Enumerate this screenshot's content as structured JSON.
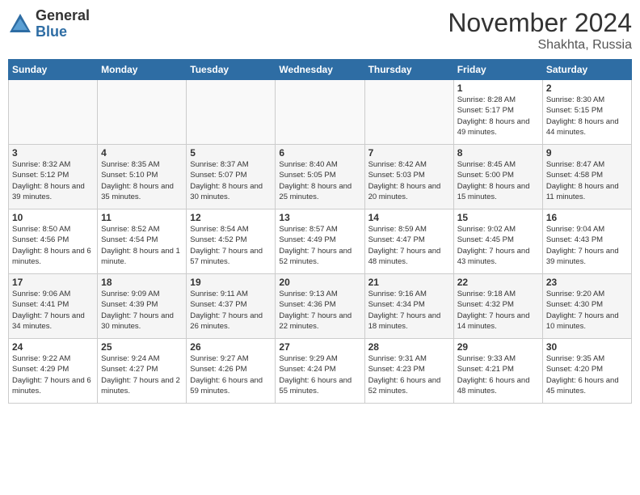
{
  "logo": {
    "general": "General",
    "blue": "Blue"
  },
  "title": "November 2024",
  "location": "Shakhta, Russia",
  "days_header": [
    "Sunday",
    "Monday",
    "Tuesday",
    "Wednesday",
    "Thursday",
    "Friday",
    "Saturday"
  ],
  "weeks": [
    [
      {
        "day": "",
        "info": ""
      },
      {
        "day": "",
        "info": ""
      },
      {
        "day": "",
        "info": ""
      },
      {
        "day": "",
        "info": ""
      },
      {
        "day": "",
        "info": ""
      },
      {
        "day": "1",
        "info": "Sunrise: 8:28 AM\nSunset: 5:17 PM\nDaylight: 8 hours and 49 minutes."
      },
      {
        "day": "2",
        "info": "Sunrise: 8:30 AM\nSunset: 5:15 PM\nDaylight: 8 hours and 44 minutes."
      }
    ],
    [
      {
        "day": "3",
        "info": "Sunrise: 8:32 AM\nSunset: 5:12 PM\nDaylight: 8 hours and 39 minutes."
      },
      {
        "day": "4",
        "info": "Sunrise: 8:35 AM\nSunset: 5:10 PM\nDaylight: 8 hours and 35 minutes."
      },
      {
        "day": "5",
        "info": "Sunrise: 8:37 AM\nSunset: 5:07 PM\nDaylight: 8 hours and 30 minutes."
      },
      {
        "day": "6",
        "info": "Sunrise: 8:40 AM\nSunset: 5:05 PM\nDaylight: 8 hours and 25 minutes."
      },
      {
        "day": "7",
        "info": "Sunrise: 8:42 AM\nSunset: 5:03 PM\nDaylight: 8 hours and 20 minutes."
      },
      {
        "day": "8",
        "info": "Sunrise: 8:45 AM\nSunset: 5:00 PM\nDaylight: 8 hours and 15 minutes."
      },
      {
        "day": "9",
        "info": "Sunrise: 8:47 AM\nSunset: 4:58 PM\nDaylight: 8 hours and 11 minutes."
      }
    ],
    [
      {
        "day": "10",
        "info": "Sunrise: 8:50 AM\nSunset: 4:56 PM\nDaylight: 8 hours and 6 minutes."
      },
      {
        "day": "11",
        "info": "Sunrise: 8:52 AM\nSunset: 4:54 PM\nDaylight: 8 hours and 1 minute."
      },
      {
        "day": "12",
        "info": "Sunrise: 8:54 AM\nSunset: 4:52 PM\nDaylight: 7 hours and 57 minutes."
      },
      {
        "day": "13",
        "info": "Sunrise: 8:57 AM\nSunset: 4:49 PM\nDaylight: 7 hours and 52 minutes."
      },
      {
        "day": "14",
        "info": "Sunrise: 8:59 AM\nSunset: 4:47 PM\nDaylight: 7 hours and 48 minutes."
      },
      {
        "day": "15",
        "info": "Sunrise: 9:02 AM\nSunset: 4:45 PM\nDaylight: 7 hours and 43 minutes."
      },
      {
        "day": "16",
        "info": "Sunrise: 9:04 AM\nSunset: 4:43 PM\nDaylight: 7 hours and 39 minutes."
      }
    ],
    [
      {
        "day": "17",
        "info": "Sunrise: 9:06 AM\nSunset: 4:41 PM\nDaylight: 7 hours and 34 minutes."
      },
      {
        "day": "18",
        "info": "Sunrise: 9:09 AM\nSunset: 4:39 PM\nDaylight: 7 hours and 30 minutes."
      },
      {
        "day": "19",
        "info": "Sunrise: 9:11 AM\nSunset: 4:37 PM\nDaylight: 7 hours and 26 minutes."
      },
      {
        "day": "20",
        "info": "Sunrise: 9:13 AM\nSunset: 4:36 PM\nDaylight: 7 hours and 22 minutes."
      },
      {
        "day": "21",
        "info": "Sunrise: 9:16 AM\nSunset: 4:34 PM\nDaylight: 7 hours and 18 minutes."
      },
      {
        "day": "22",
        "info": "Sunrise: 9:18 AM\nSunset: 4:32 PM\nDaylight: 7 hours and 14 minutes."
      },
      {
        "day": "23",
        "info": "Sunrise: 9:20 AM\nSunset: 4:30 PM\nDaylight: 7 hours and 10 minutes."
      }
    ],
    [
      {
        "day": "24",
        "info": "Sunrise: 9:22 AM\nSunset: 4:29 PM\nDaylight: 7 hours and 6 minutes."
      },
      {
        "day": "25",
        "info": "Sunrise: 9:24 AM\nSunset: 4:27 PM\nDaylight: 7 hours and 2 minutes."
      },
      {
        "day": "26",
        "info": "Sunrise: 9:27 AM\nSunset: 4:26 PM\nDaylight: 6 hours and 59 minutes."
      },
      {
        "day": "27",
        "info": "Sunrise: 9:29 AM\nSunset: 4:24 PM\nDaylight: 6 hours and 55 minutes."
      },
      {
        "day": "28",
        "info": "Sunrise: 9:31 AM\nSunset: 4:23 PM\nDaylight: 6 hours and 52 minutes."
      },
      {
        "day": "29",
        "info": "Sunrise: 9:33 AM\nSunset: 4:21 PM\nDaylight: 6 hours and 48 minutes."
      },
      {
        "day": "30",
        "info": "Sunrise: 9:35 AM\nSunset: 4:20 PM\nDaylight: 6 hours and 45 minutes."
      }
    ]
  ]
}
